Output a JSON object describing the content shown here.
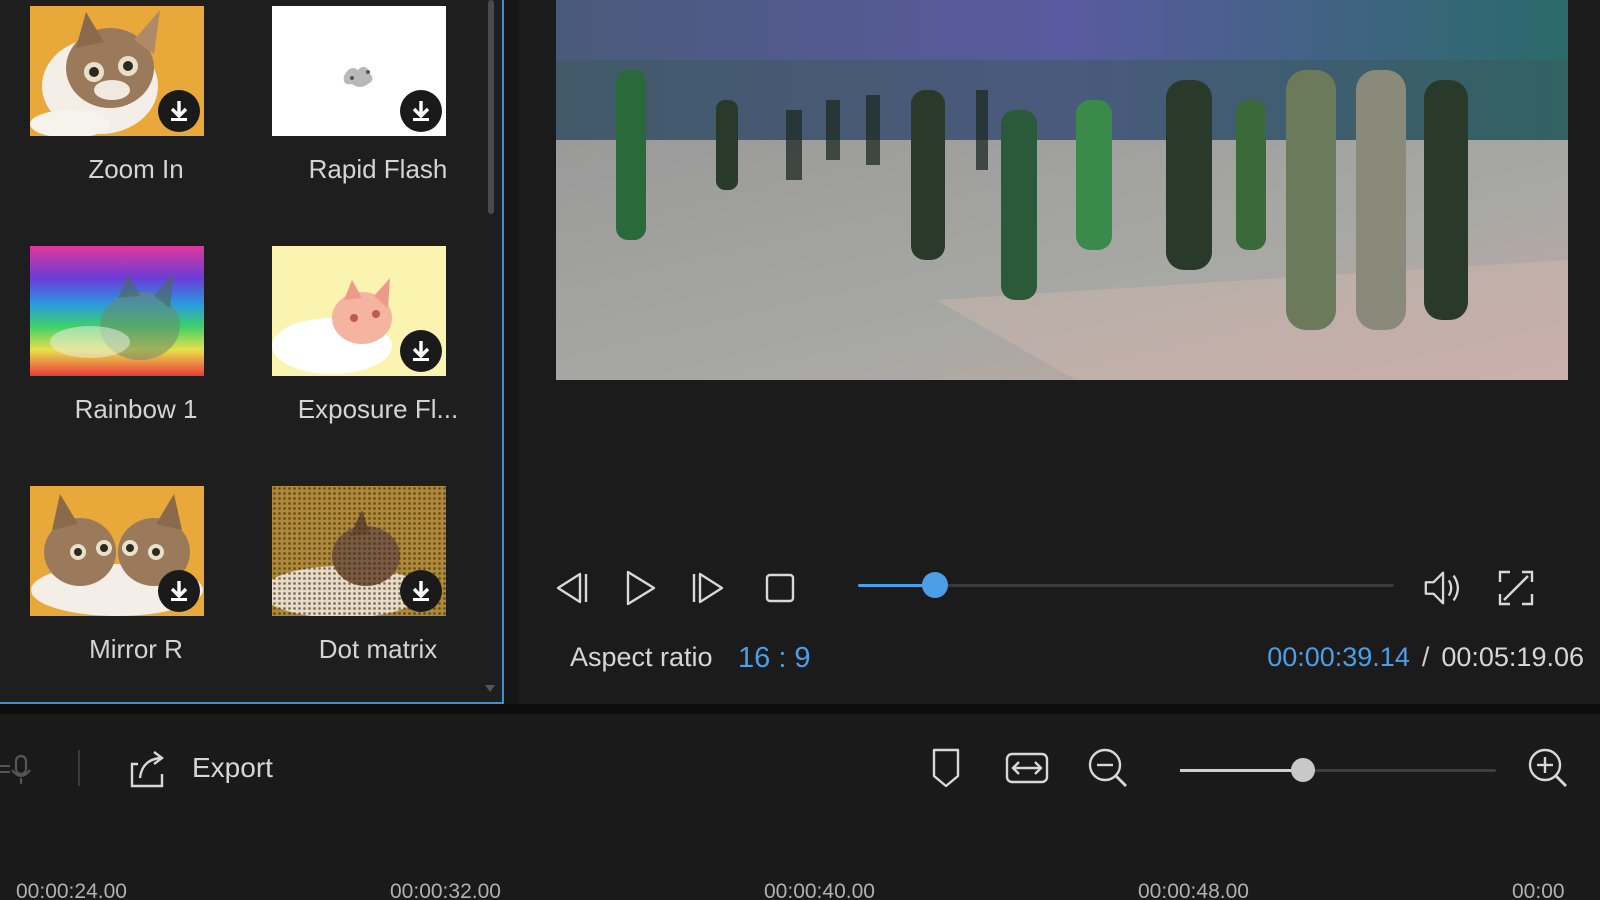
{
  "effects": {
    "items": [
      {
        "label": "Zoom In",
        "downloadable": true,
        "thumb": "cat"
      },
      {
        "label": "Rapid Flash",
        "downloadable": true,
        "thumb": "white-flash"
      },
      {
        "label": "Rainbow 1",
        "downloadable": false,
        "thumb": "rainbow"
      },
      {
        "label": "Exposure Fl...",
        "downloadable": true,
        "thumb": "exposure"
      },
      {
        "label": "Mirror R",
        "downloadable": true,
        "thumb": "mirror"
      },
      {
        "label": "Dot matrix",
        "downloadable": true,
        "thumb": "dotmatrix"
      }
    ]
  },
  "player": {
    "aspect_label": "Aspect ratio",
    "aspect_value": "16 : 9",
    "current_time": "00:00:39.14",
    "separator": "/",
    "total_time": "00:05:19.06",
    "progress_fraction": 0.143
  },
  "toolbar": {
    "export_label": "Export",
    "zoom_fraction": 0.39
  },
  "ruler": {
    "ticks": [
      "00:00:24.00",
      "00:00:32.00",
      "00:00:40.00",
      "00:00:48.00",
      "00:00"
    ]
  },
  "colors": {
    "accent": "#4a9fe8",
    "panel_border": "#3f8fd6",
    "background": "#161616"
  }
}
